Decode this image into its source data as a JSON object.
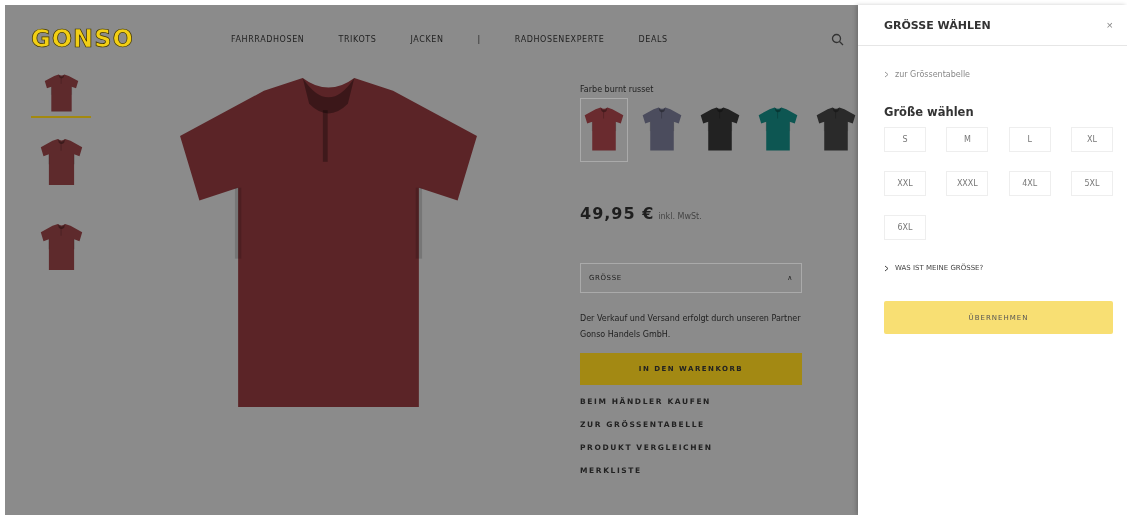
{
  "header": {
    "logo": "GONSO",
    "nav": [
      "FAHRRADHOSEN",
      "TRIKOTS",
      "JACKEN",
      "|",
      "RADHOSENEXPERTE",
      "DEALS"
    ]
  },
  "thumbnails": [
    {
      "selected": true,
      "color": "#5e2a2c"
    },
    {
      "selected": false,
      "color": "#5e2a2c"
    },
    {
      "selected": false,
      "color": "#5e2a2c"
    }
  ],
  "product": {
    "color_label": "Farbe burnt russet",
    "swatches": [
      {
        "color": "#6a2b2f",
        "selected": true
      },
      {
        "color": "#4b4c5d",
        "selected": false
      },
      {
        "color": "#222222",
        "selected": false
      },
      {
        "color": "#0d5652",
        "selected": false
      },
      {
        "color": "#2a2a2a",
        "selected": false
      }
    ],
    "price": "49,95 €",
    "price_note": "inkl. MwSt.",
    "size_select": "GRÖSSE",
    "caret": "∧",
    "seller_note": "Der Verkauf und Versand erfolgt durch unseren Partner Gonso Handels GmbH.",
    "cart_button": "IN DEN WARENKORB",
    "links": [
      "BEIM HÄNDLER KAUFEN",
      "ZUR GRÖSSENTABELLE",
      "PRODUKT VERGLEICHEN",
      "MERKLISTE"
    ]
  },
  "drawer": {
    "title": "GRÖSSE WÄHLEN",
    "close": "×",
    "size_chart_link": "zur Grössentabelle",
    "heading": "Größe wählen",
    "sizes": [
      {
        "label": "S",
        "selected": false
      },
      {
        "label": "M",
        "selected": false
      },
      {
        "label": "L",
        "selected": false
      },
      {
        "label": "XL",
        "selected": false
      },
      {
        "label": "XXL",
        "selected": false
      },
      {
        "label": "XXXL",
        "selected": false
      },
      {
        "label": "4XL",
        "selected": false
      },
      {
        "label": "5XL",
        "selected": false
      },
      {
        "label": "6XL",
        "selected": false
      }
    ],
    "help_link": "WAS IST MEINE GRÖSSE?",
    "apply_button": "ÜBERNEHMEN"
  }
}
